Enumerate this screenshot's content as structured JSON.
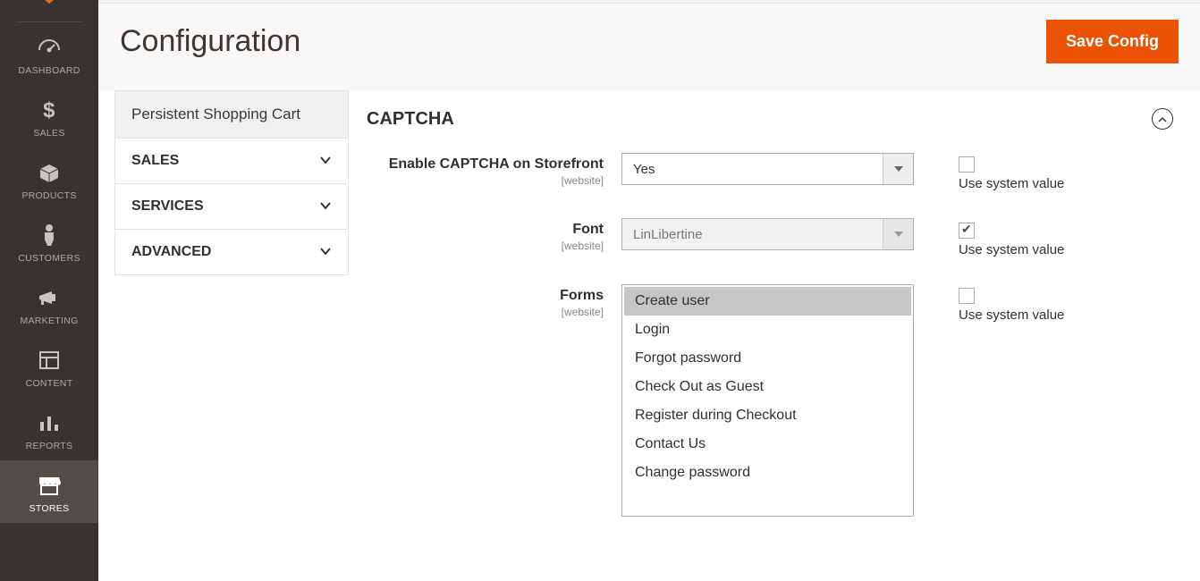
{
  "nav": [
    {
      "id": "dashboard",
      "label": "DASHBOARD"
    },
    {
      "id": "sales",
      "label": "SALES"
    },
    {
      "id": "products",
      "label": "PRODUCTS"
    },
    {
      "id": "customers",
      "label": "CUSTOMERS"
    },
    {
      "id": "marketing",
      "label": "MARKETING"
    },
    {
      "id": "content",
      "label": "CONTENT"
    },
    {
      "id": "reports",
      "label": "REPORTS"
    },
    {
      "id": "stores",
      "label": "STORES",
      "active": true
    }
  ],
  "header": {
    "title": "Configuration",
    "save_label": "Save Config"
  },
  "tree": {
    "sub": "Persistent Shopping Cart",
    "items": [
      "SALES",
      "SERVICES",
      "ADVANCED"
    ]
  },
  "section_title": "CAPTCHA",
  "scope_label": "[website]",
  "use_system_label": "Use system value",
  "fields": {
    "enable": {
      "label": "Enable CAPTCHA on Storefront",
      "value": "Yes",
      "use_system": false
    },
    "font": {
      "label": "Font",
      "value": "LinLibertine",
      "use_system": true
    },
    "forms": {
      "label": "Forms",
      "options": [
        "Create user",
        "Login",
        "Forgot password",
        "Check Out as Guest",
        "Register during Checkout",
        "Contact Us",
        "Change password"
      ],
      "selected": [
        0
      ],
      "use_system": false
    }
  }
}
